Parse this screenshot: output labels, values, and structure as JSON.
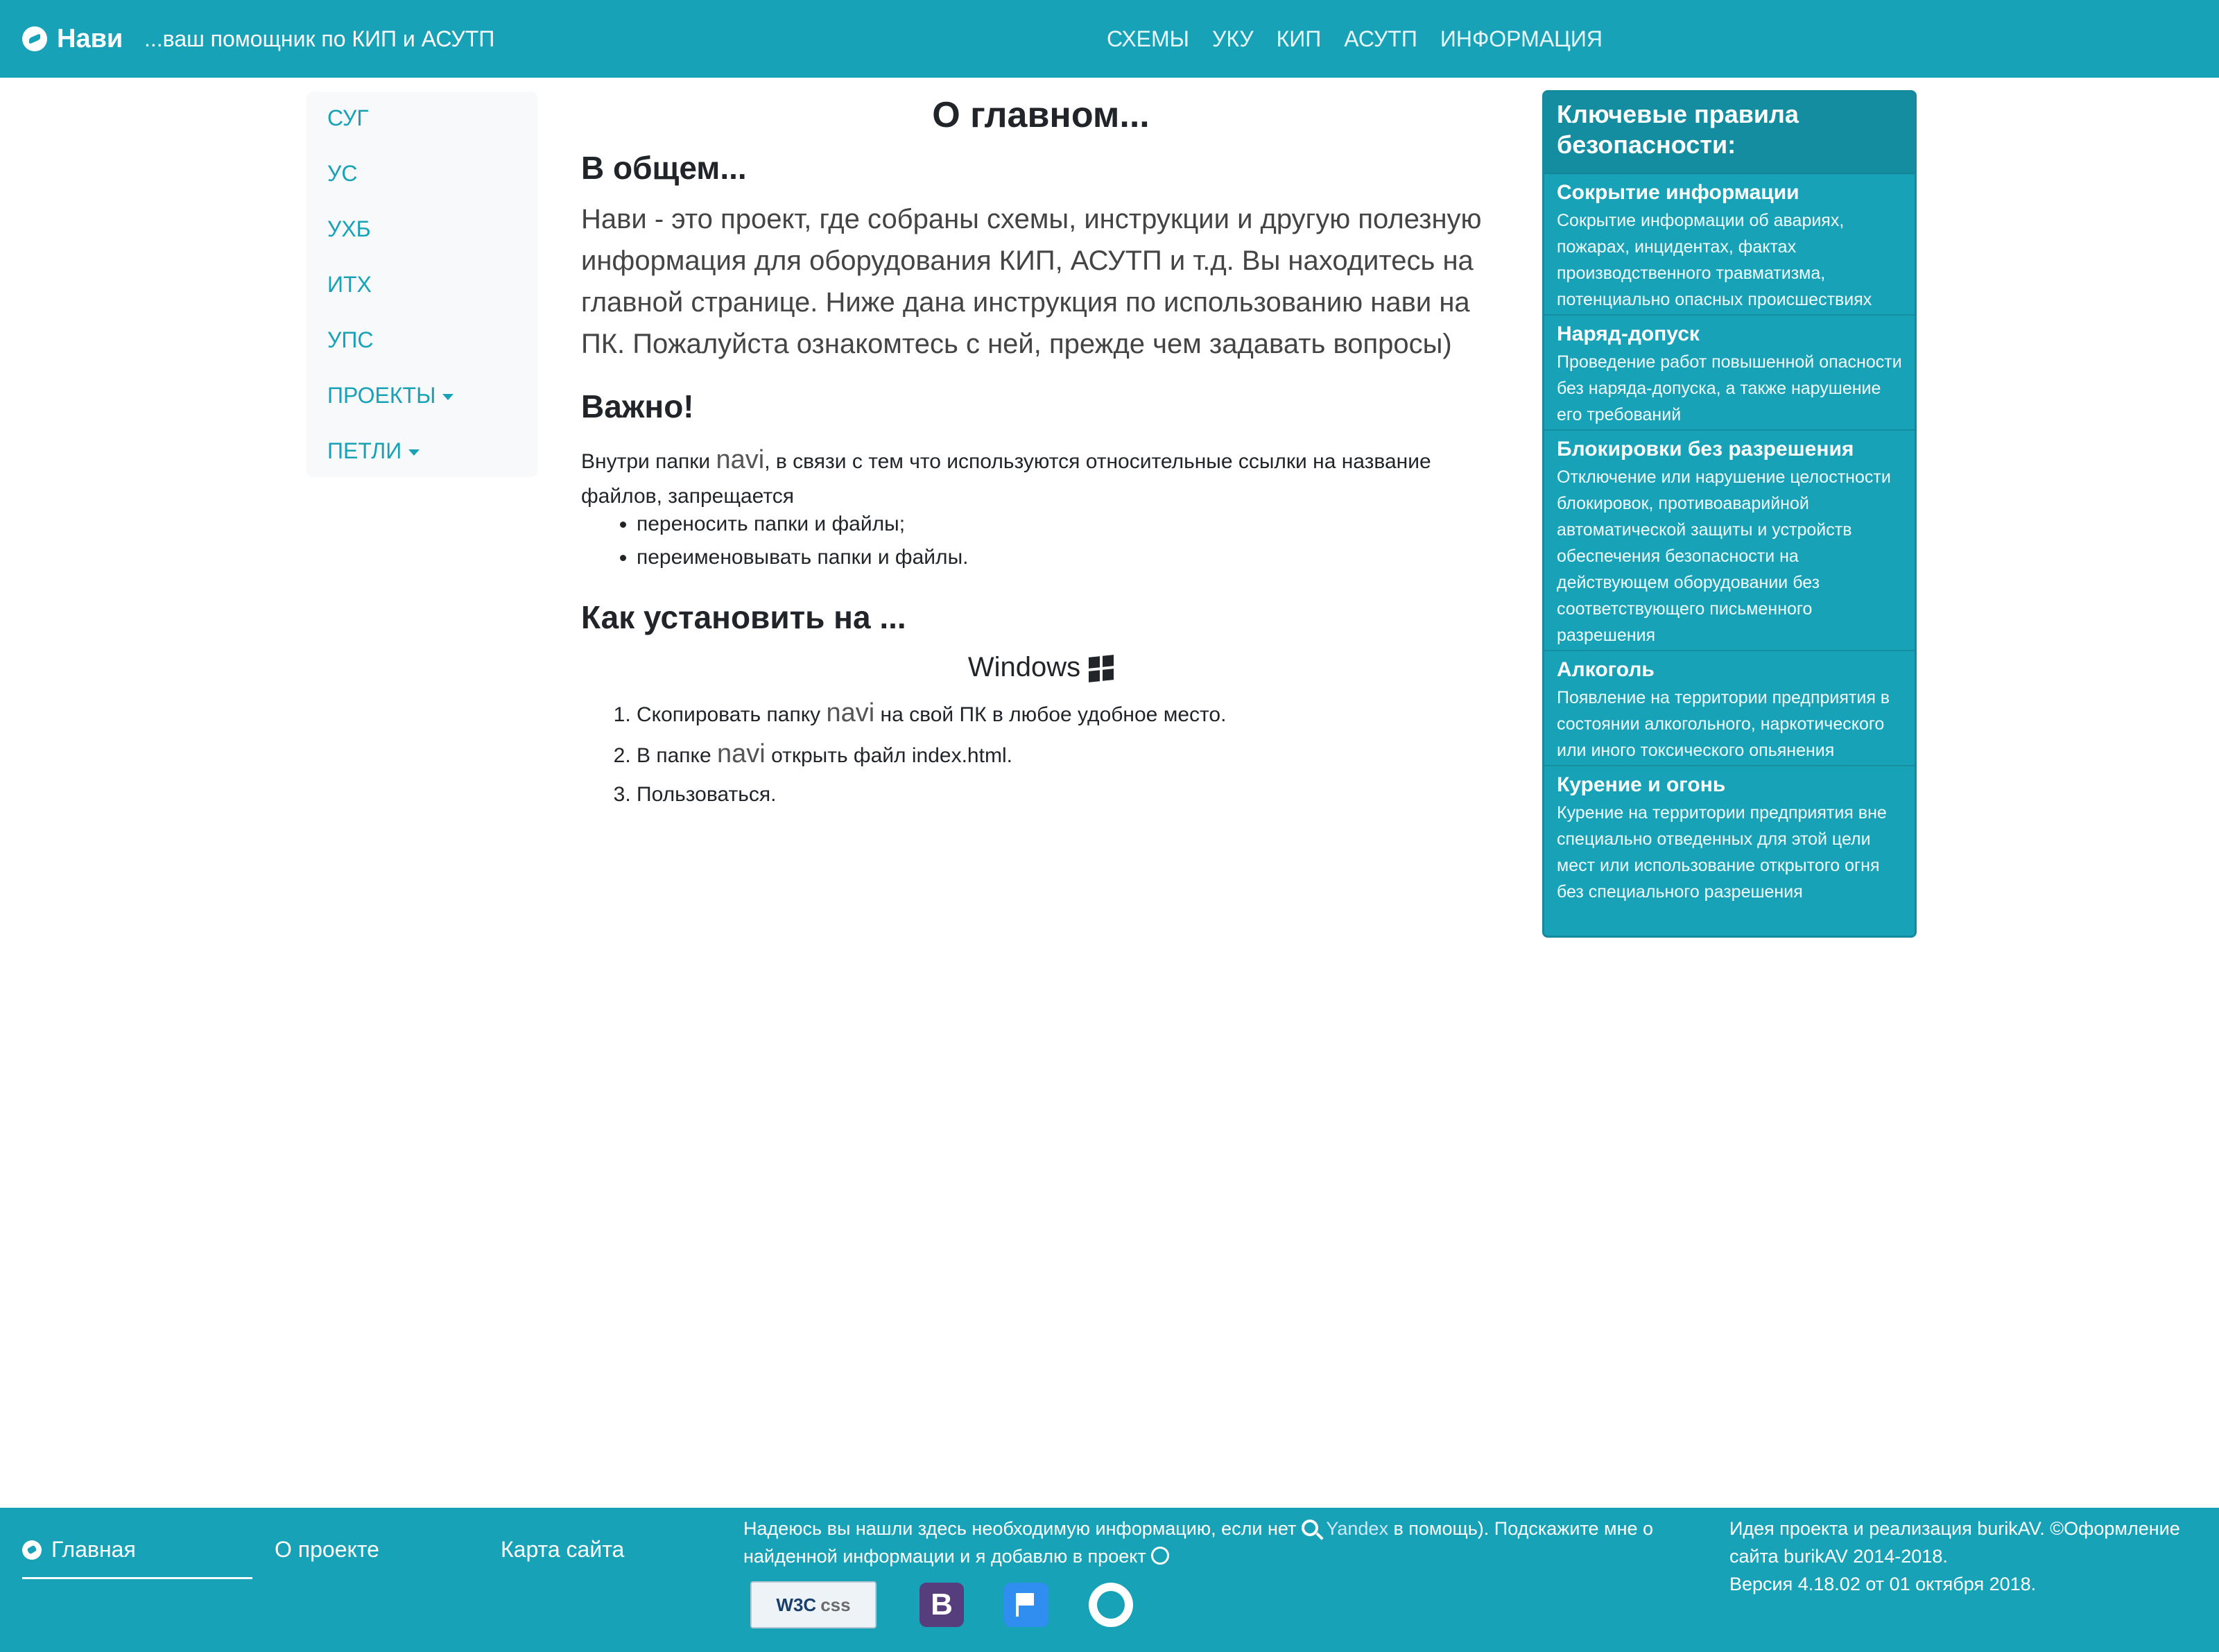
{
  "navbar": {
    "brand": "Нави",
    "tagline": "...ваш помощник по КИП и АСУТП",
    "links": [
      "СХЕМЫ",
      "УКУ",
      "КИП",
      "АСУТП",
      "ИНФОРМАЦИЯ"
    ]
  },
  "sidebar": {
    "items": [
      {
        "label": "СУГ"
      },
      {
        "label": "УС"
      },
      {
        "label": "УХБ"
      },
      {
        "label": "ИТХ"
      },
      {
        "label": "УПС"
      },
      {
        "label": "ПРОЕКТЫ"
      },
      {
        "label": "ПЕТЛИ"
      }
    ]
  },
  "main": {
    "title": "О главном...",
    "general": {
      "heading": "В общем...",
      "lead": "Нави - это проект, где собраны схемы, инструкции и другую полезную информация для оборудования КИП, АСУТП и т.д. Вы находитесь на главной странице. Ниже дана инструкция по использованию нави на ПК. Пожалуйста ознакомтесь с ней, прежде чем задавать вопросы)"
    },
    "important": {
      "heading": "Важно!",
      "text_before": "Внутри папки ",
      "folder": "navi",
      "text_after": ", в связи с тем что используются относительные ссылки на название файлов, запрещается",
      "items": [
        "переносить папки и файлы;",
        "переименовывать папки и файлы."
      ]
    },
    "install": {
      "heading": "Как установить на ...",
      "os": "Windows",
      "steps": [
        {
          "before": "Скопировать папку ",
          "folder": "navi",
          "after": " на свой ПК в любое удобное место."
        },
        {
          "before": "В папке ",
          "folder": "navi",
          "after": " открыть файл index.html."
        },
        {
          "before": "Пользоваться.",
          "folder": "",
          "after": ""
        }
      ]
    }
  },
  "rules_panel": {
    "title": "Ключевые правила безопасности:",
    "items": [
      {
        "title": "Сокрытие информации",
        "text": "Сокрытие информации об авариях, пожарах, инцидентах, фактах производственного травматизма, потенциально опасных происшествиях"
      },
      {
        "title": "Наряд-допуск",
        "text": "Проведение работ повышенной опасности без наряда-допуска, а также нарушение его требований"
      },
      {
        "title": "Блокировки без разрешения",
        "text": "Отключение или нарушение целостности блокировок, противоаварийной автоматической защиты и устройств обеспечения безопасности на действующем оборудовании без соответствующего письменного разрешения"
      },
      {
        "title": "Алкоголь",
        "text": "Появление на территории предприятия в состоянии алкогольного, наркотического или иного токсического опьянения"
      },
      {
        "title": "Курение и огонь",
        "text": "Курение на территории предприятия вне специально отведенных для этой цели мест или использование открытого огня без специального разрешения"
      }
    ]
  },
  "footer": {
    "nav": [
      "Главная",
      "О проекте",
      "Карта сайта"
    ],
    "message_before": "Надеюсь вы нашли здесь необходимую информацию, если нет ",
    "yandex": "Yandex",
    "message_after": " в помощь). Подскажите мне о найденной информации и я добавлю в проект",
    "css_badge": "W3C",
    "css_badge_sub": "css",
    "bootstrap_badge": "B",
    "copyright_line1": "Идея проекта и реализация burikAV. ©Оформление сайта burikAV 2014-2018.",
    "copyright_line2": "Версия 4.18.02 от 01 октября 2018."
  },
  "colors": {
    "accent": "#17a2b8",
    "text": "#212529",
    "sidebar_bg": "#f8f9fa"
  }
}
